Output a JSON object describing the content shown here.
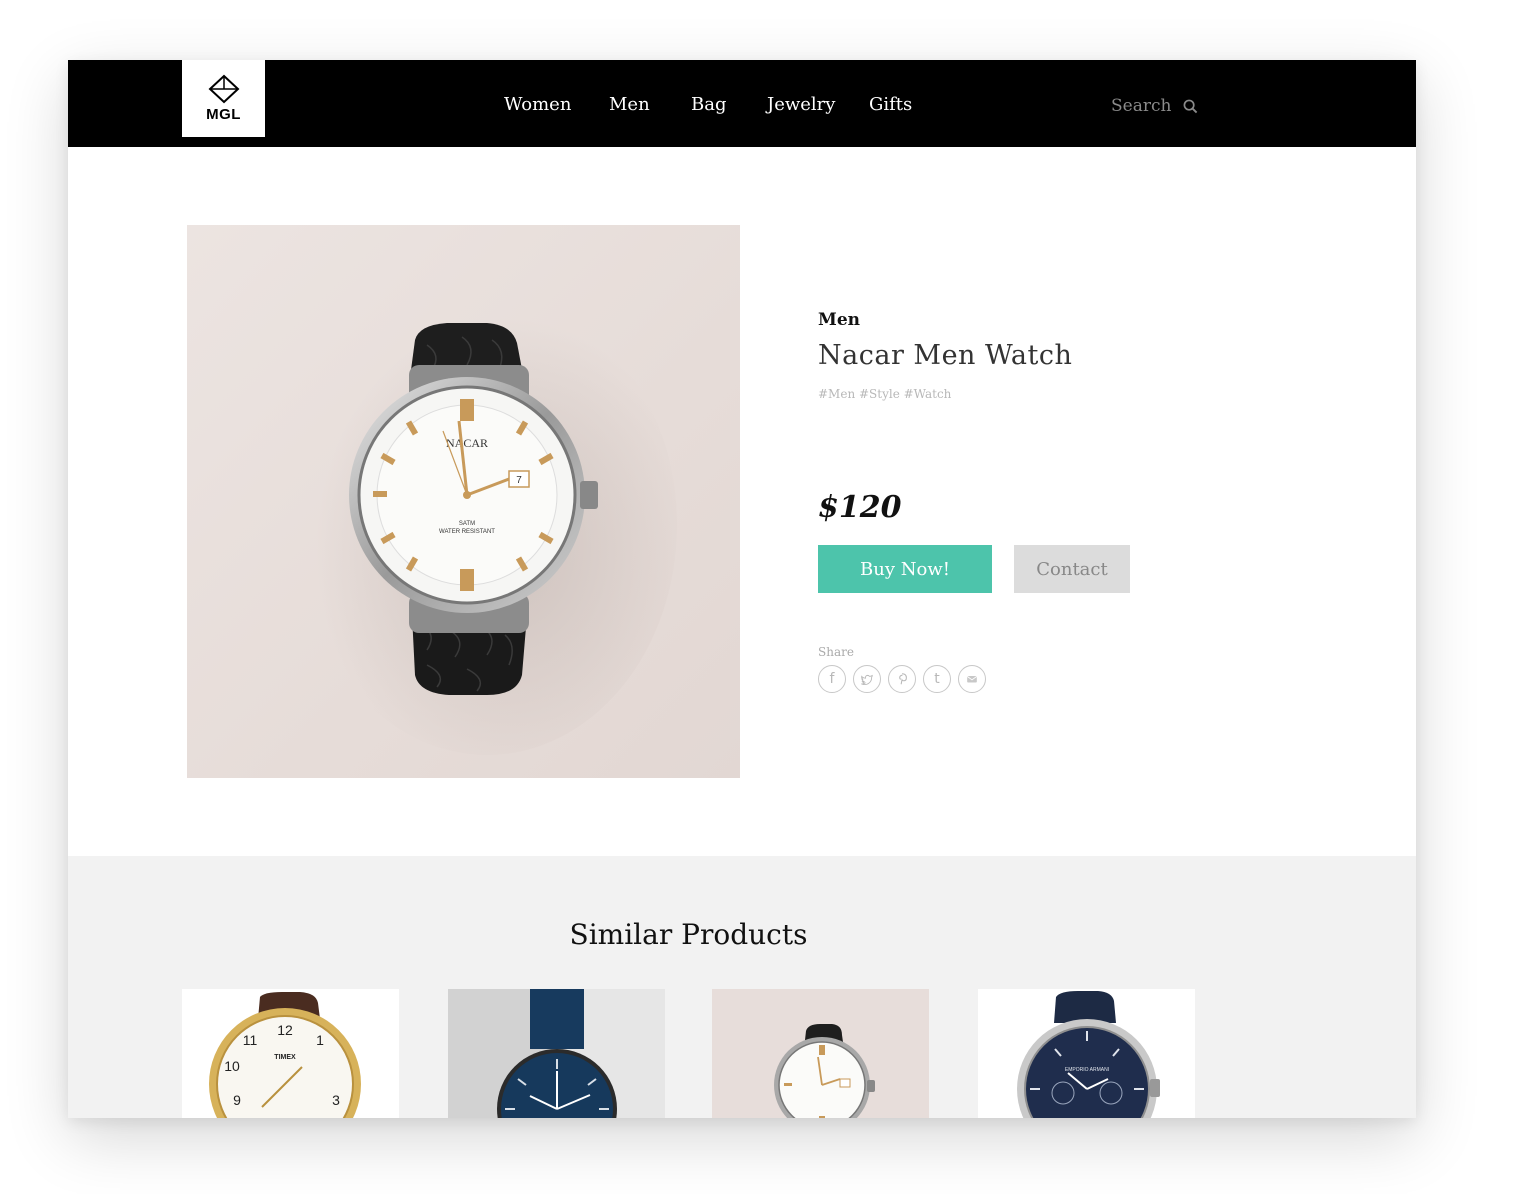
{
  "header": {
    "logo_text": "MGL",
    "nav": [
      "Women",
      "Men",
      "Bag",
      "Jewelry",
      "Gifts"
    ],
    "search_placeholder": "Search"
  },
  "product": {
    "category": "Men",
    "title": "Nacar Men Watch",
    "tags": "#Men #Style #Watch",
    "price": "$120",
    "buy_label": "Buy Now!",
    "contact_label": "Contact",
    "share_label": "Share",
    "share_icons": [
      "facebook-icon",
      "twitter-icon",
      "pinterest-icon",
      "tumblr-icon",
      "mail-icon"
    ]
  },
  "similar": {
    "title": "Similar Products",
    "items": [
      "timex-watch",
      "navy-minimal-watch",
      "nacar-watch",
      "armani-chrono-watch"
    ]
  },
  "colors": {
    "header_bg": "#000000",
    "accent": "#4dc4ab",
    "contact_bg": "#dcdcdc",
    "similar_bg": "#f2f2f2"
  }
}
